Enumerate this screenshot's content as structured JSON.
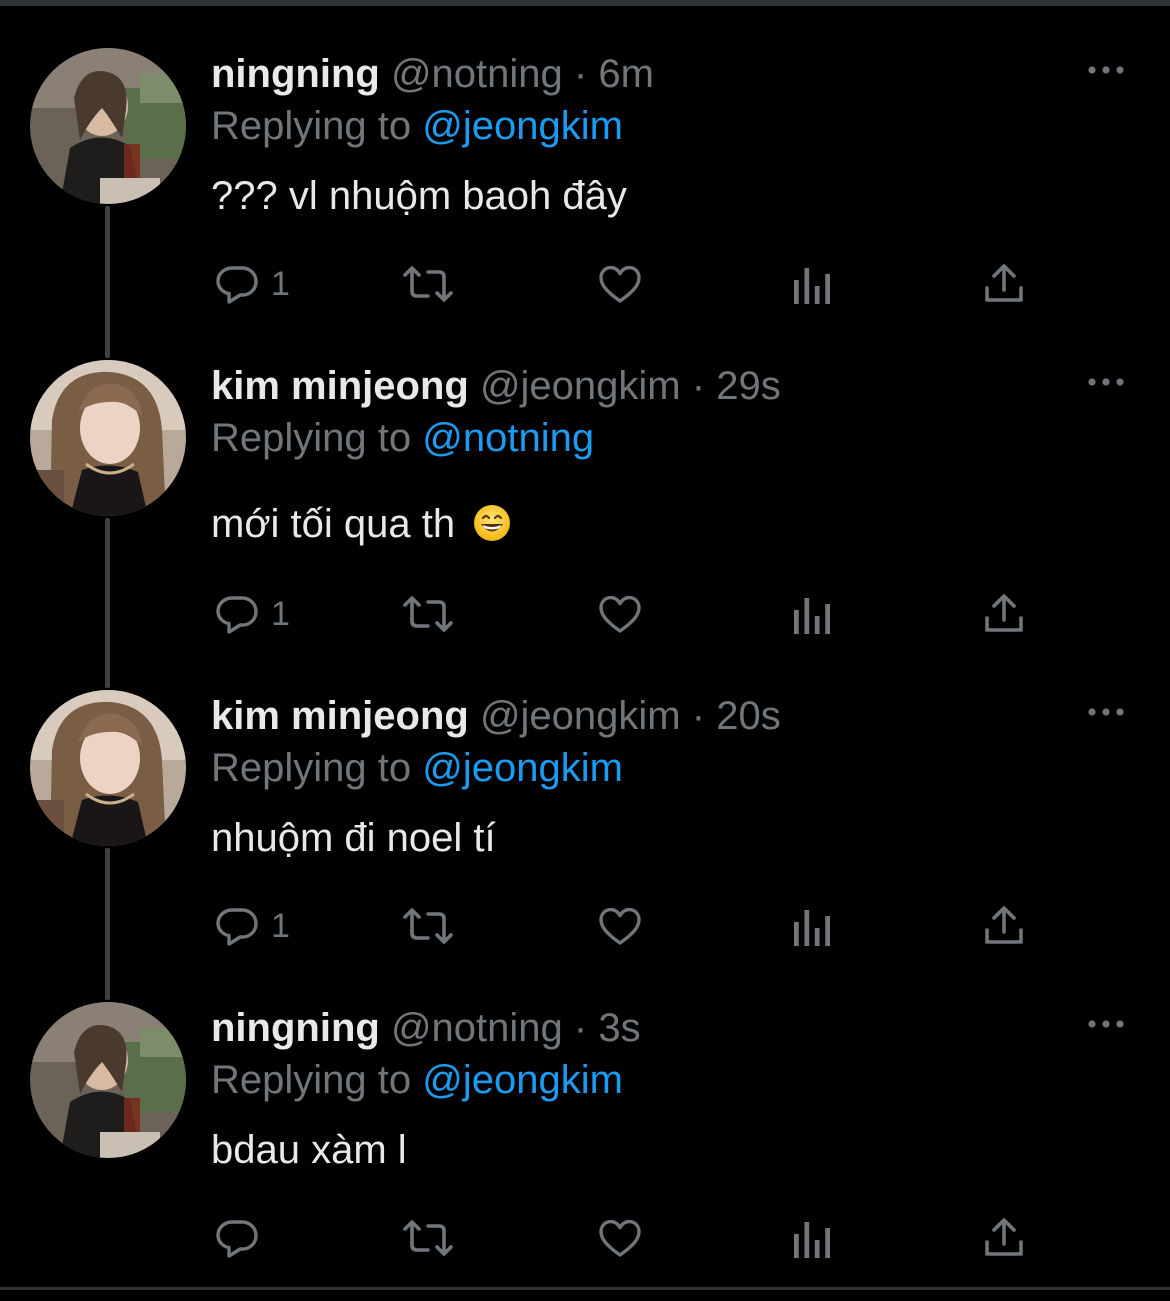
{
  "colors": {
    "background": "#000000",
    "text": "#e7e9ea",
    "secondary": "#71767b",
    "accent": "#1d9bf0",
    "thread_line": "#3d4145"
  },
  "tweets": [
    {
      "name": "ningning",
      "handle": "@notning",
      "separator": "·",
      "time": "6m",
      "replying_prefix": "Replying to",
      "replying_to": "@jeongkim",
      "text": "??? vl nhuộm baoh đây",
      "reply_count": "1",
      "avatar": "ningning-avatar"
    },
    {
      "name": "kim minjeong",
      "handle": "@jeongkim",
      "separator": "·",
      "time": "29s",
      "replying_prefix": "Replying to",
      "replying_to": "@notning",
      "text": "mới tối qua th",
      "emoji": "grinning-face-emoji",
      "reply_count": "1",
      "avatar": "minjeong-avatar"
    },
    {
      "name": "kim minjeong",
      "handle": "@jeongkim",
      "separator": "·",
      "time": "20s",
      "replying_prefix": "Replying to",
      "replying_to": "@jeongkim",
      "text": "nhuộm đi noel tí",
      "reply_count": "1",
      "avatar": "minjeong-avatar"
    },
    {
      "name": "ningning",
      "handle": "@notning",
      "separator": "·",
      "time": "3s",
      "replying_prefix": "Replying to",
      "replying_to": "@jeongkim",
      "text": "bdau xàm l",
      "reply_count": "",
      "avatar": "ningning-avatar"
    }
  ],
  "action_icons": [
    "reply-icon",
    "retweet-icon",
    "like-icon",
    "analytics-icon",
    "share-icon"
  ],
  "more_icon": "more-options-icon"
}
